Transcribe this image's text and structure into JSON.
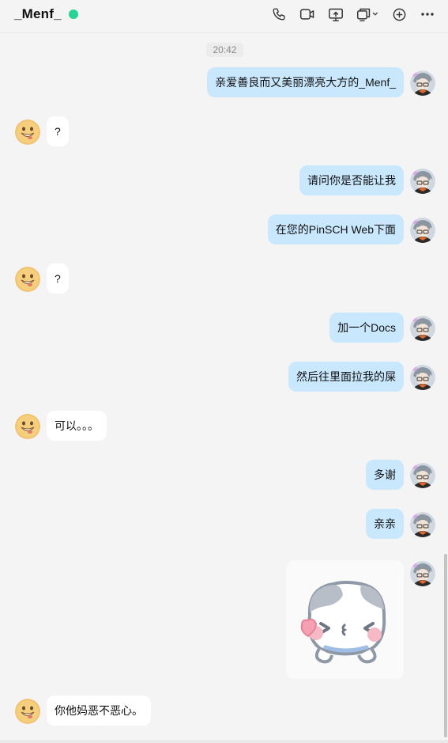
{
  "header": {
    "title": "_Menf_",
    "status_color": "#29d394",
    "tools": [
      "phone-icon",
      "video-icon",
      "screen-share-icon",
      "remote-assist-icon",
      "add-icon",
      "more-icon"
    ]
  },
  "conversation": {
    "timestamp": "20:42",
    "messages": [
      {
        "side": "right",
        "text": "亲爱善良而又美丽漂亮大方的_Menf_"
      },
      {
        "side": "left",
        "text": "?"
      },
      {
        "side": "right",
        "text": "请问你是否能让我"
      },
      {
        "side": "right",
        "text": "在您的PinSCH Web下面"
      },
      {
        "side": "left",
        "text": "?"
      },
      {
        "side": "right",
        "text": "加一个Docs"
      },
      {
        "side": "right",
        "text": "然后往里面拉我的屎"
      },
      {
        "side": "left",
        "text": "可以。。。"
      },
      {
        "side": "right",
        "text": "多谢"
      },
      {
        "side": "right",
        "text": "亲亲"
      },
      {
        "side": "right",
        "type": "sticker",
        "sticker": "cat-blushing-sticker"
      },
      {
        "side": "left",
        "text": "你他妈恶不恶心。"
      }
    ]
  },
  "colors": {
    "outgoing_bubble": "#c9e8fd",
    "incoming_bubble": "#ffffff",
    "background": "#f4f4f4"
  }
}
